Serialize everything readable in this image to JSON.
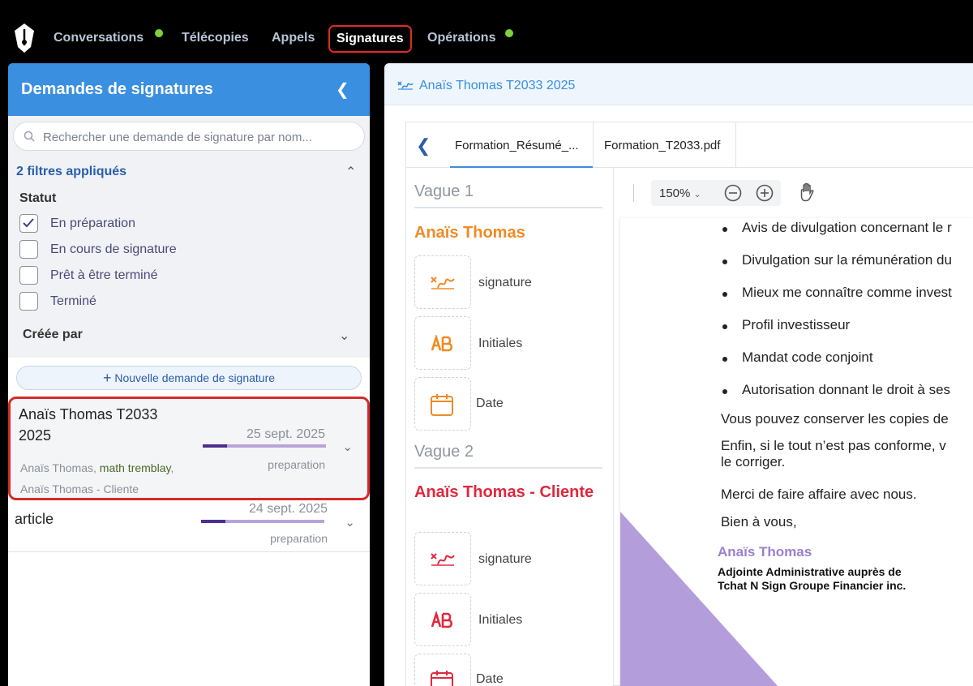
{
  "topnav": {
    "items": [
      {
        "label": "Conversations",
        "has_dot": true
      },
      {
        "label": "Télécopies",
        "has_dot": false
      },
      {
        "label": "Appels",
        "has_dot": false
      },
      {
        "label": "Signatures",
        "has_dot": false,
        "active": true
      },
      {
        "label": "Opérations",
        "has_dot": true
      }
    ],
    "dot_color": "#7dd13a"
  },
  "sidebar": {
    "title": "Demandes de signatures",
    "search_placeholder": "Rechercher une demande de signature par nom...",
    "filters_title": "2 filtres appliqués",
    "statut_label": "Statut",
    "statuses": [
      {
        "label": "En préparation",
        "checked": true
      },
      {
        "label": "En cours de signature",
        "checked": false
      },
      {
        "label": "Prêt à être terminé",
        "checked": false
      },
      {
        "label": "Terminé",
        "checked": false
      }
    ],
    "created_by_label": "Créée par",
    "new_request_label": "Nouvelle demande de signature",
    "requests": [
      {
        "title_line1": "Anaïs Thomas T2033",
        "title_line2": "2025",
        "date": "25 sept. 2025",
        "status": "preparation",
        "progress": 0.2,
        "signer1": "Anaïs Thomas",
        "signer2": "math tremblay",
        "signer3": "Anaïs Thomas - Cliente"
      },
      {
        "title_line1": "article",
        "date": "24 sept. 2025",
        "status": "preparation",
        "progress": 0.2
      }
    ]
  },
  "document": {
    "title": "Anaïs Thomas T2033 2025",
    "tabs": [
      "Formation_Résumé_...",
      "Formation_T2033.pdf"
    ],
    "waves": [
      {
        "label": "Vague 1",
        "signer": "Anaïs Thomas",
        "color": "#f08a24",
        "fields": [
          "signature",
          "Initiales",
          "Date"
        ]
      },
      {
        "label": "Vague 2",
        "signer": "Anaïs Thomas - Cliente",
        "color": "#e0283e",
        "fields": [
          "signature",
          "Initiales",
          "Date"
        ]
      }
    ],
    "zoom": "150%",
    "pdf": {
      "bullets": [
        "Avis de divulgation concernant le r",
        "Divulgation sur la rémunération du",
        "Mieux me connaître comme invest",
        "Profil investisseur",
        "Mandat code conjoint",
        "Autorisation donnant le droit à ses"
      ],
      "para1": "Vous pouvez conserver les copies de",
      "para2_line1": "Enfin, si le tout n’est pas conforme, v",
      "para2_line2": "le corriger.",
      "para3": "Merci de faire affaire avec nous.",
      "para4": "Bien à vous,",
      "sign_name": "Anaïs Thomas",
      "sign_role_line1": "Adjointe Administrative auprès de",
      "sign_role_line2": "Tchat N Sign Groupe Financier inc."
    }
  }
}
